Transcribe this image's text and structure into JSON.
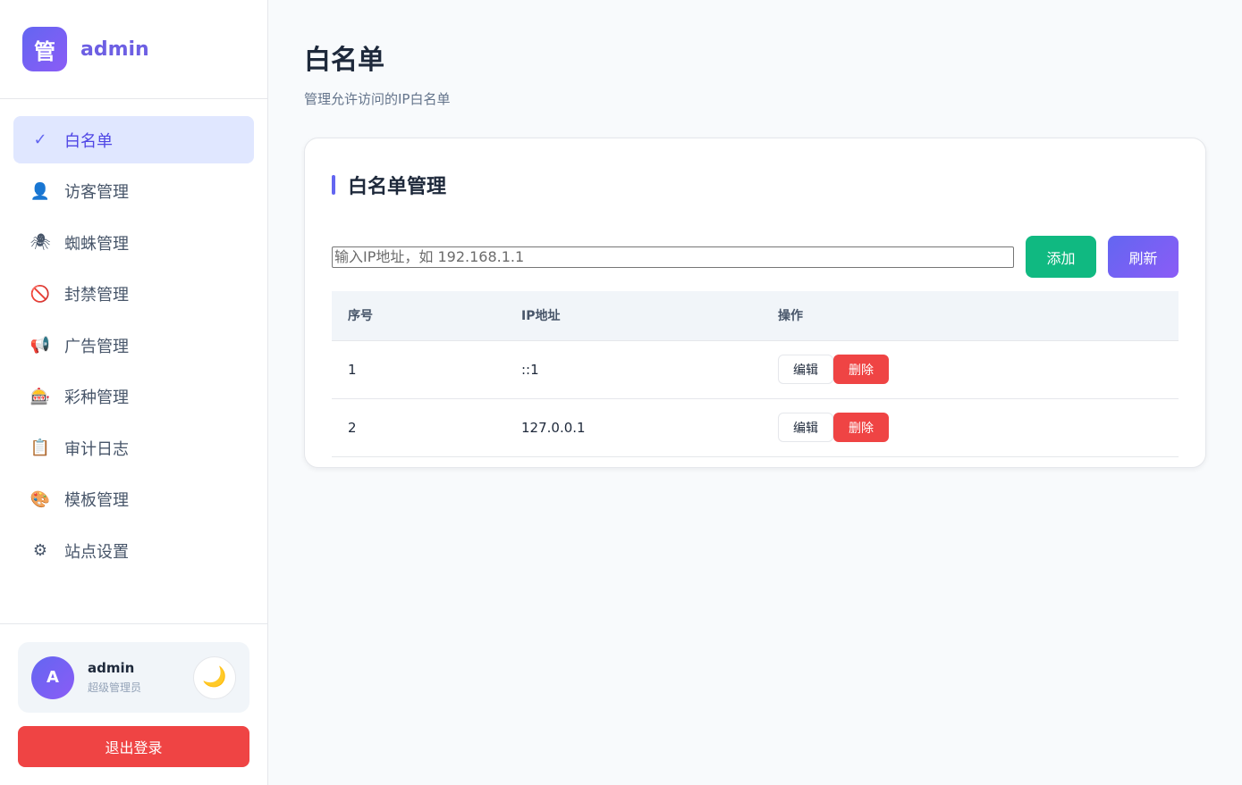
{
  "brand": {
    "logo_char": "管",
    "name": "admin"
  },
  "nav": {
    "items": [
      {
        "icon": "check-icon",
        "glyph": "✓",
        "label": "白名单",
        "active": true
      },
      {
        "icon": "visitor-icon",
        "glyph": "👤",
        "label": "访客管理"
      },
      {
        "icon": "spider-icon",
        "glyph": "🕷",
        "label": "蜘蛛管理"
      },
      {
        "icon": "ban-icon",
        "glyph": "🚫",
        "label": "封禁管理"
      },
      {
        "icon": "megaphone-icon",
        "glyph": "📢",
        "label": "广告管理"
      },
      {
        "icon": "slot-machine-icon",
        "glyph": "🎰",
        "label": "彩种管理"
      },
      {
        "icon": "clipboard-icon",
        "glyph": "📋",
        "label": "审计日志"
      },
      {
        "icon": "palette-icon",
        "glyph": "🎨",
        "label": "模板管理"
      },
      {
        "icon": "gear-icon",
        "glyph": "⚙",
        "label": "站点设置"
      }
    ]
  },
  "user": {
    "avatar": "A",
    "name": "admin",
    "role": "超级管理员",
    "theme_icon": "🌙"
  },
  "logout_label": "退出登录",
  "page": {
    "title": "白名单",
    "subtitle": "管理允许访问的IP白名单"
  },
  "card": {
    "title": "白名单管理",
    "input_placeholder": "输入IP地址，如 192.168.1.1",
    "add_label": "添加",
    "refresh_label": "刷新"
  },
  "table": {
    "headers": [
      "序号",
      "IP地址",
      "操作"
    ],
    "rows": [
      {
        "idx": "1",
        "ip": "::1",
        "edit": "编辑",
        "delete": "删除"
      },
      {
        "idx": "2",
        "ip": "127.0.0.1",
        "edit": "编辑",
        "delete": "删除"
      }
    ]
  },
  "colors": {
    "accent": "#6366f1",
    "success": "#10b981",
    "danger": "#ef4444",
    "active_bg": "#e0e7ff"
  }
}
